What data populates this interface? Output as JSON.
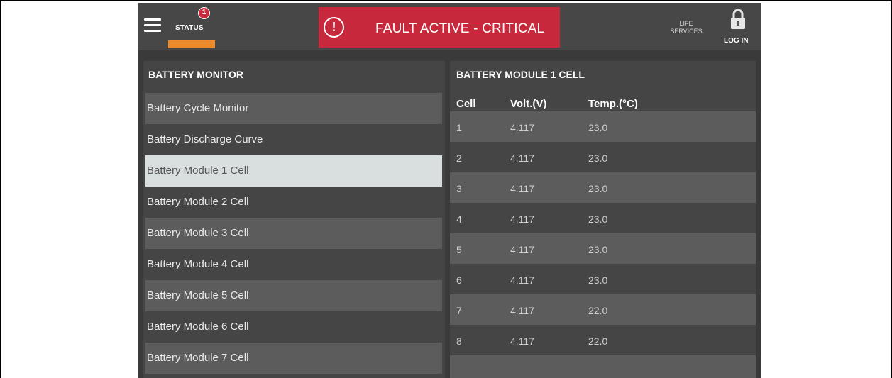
{
  "header": {
    "status_label": "STATUS",
    "status_badge_count": "1",
    "fault_icon_glyph": "!",
    "fault_text": "FAULT ACTIVE - CRITICAL",
    "life_services_line1": "LIFE",
    "life_services_line2": "SERVICES",
    "login_label": "LOG IN",
    "colors": {
      "header_bg": "#474747",
      "fault_bg": "#c8283b",
      "status_accent": "#ef8a2a"
    }
  },
  "left_panel": {
    "title": "BATTERY MONITOR",
    "items": [
      {
        "label": "Battery Cycle Monitor"
      },
      {
        "label": "Battery Discharge Curve"
      },
      {
        "label": "Battery Module 1 Cell"
      },
      {
        "label": "Battery Module 2 Cell"
      },
      {
        "label": "Battery Module 3 Cell"
      },
      {
        "label": "Battery Module 4 Cell"
      },
      {
        "label": "Battery Module 5 Cell"
      },
      {
        "label": "Battery Module 6 Cell"
      },
      {
        "label": "Battery Module 7 Cell"
      }
    ],
    "selected": "Battery Module 1 Cell"
  },
  "right_panel": {
    "title": "BATTERY MODULE 1 CELL",
    "columns": [
      "Cell",
      "Volt.(V)",
      "Temp.(°C)"
    ],
    "rows": [
      {
        "cell": "1",
        "volt": "4.117",
        "temp": "23.0"
      },
      {
        "cell": "2",
        "volt": "4.117",
        "temp": "23.0"
      },
      {
        "cell": "3",
        "volt": "4.117",
        "temp": "23.0"
      },
      {
        "cell": "4",
        "volt": "4.117",
        "temp": "23.0"
      },
      {
        "cell": "5",
        "volt": "4.117",
        "temp": "23.0"
      },
      {
        "cell": "6",
        "volt": "4.117",
        "temp": "23.0"
      },
      {
        "cell": "7",
        "volt": "4.117",
        "temp": "22.0"
      },
      {
        "cell": "8",
        "volt": "4.117",
        "temp": "22.0"
      }
    ]
  }
}
